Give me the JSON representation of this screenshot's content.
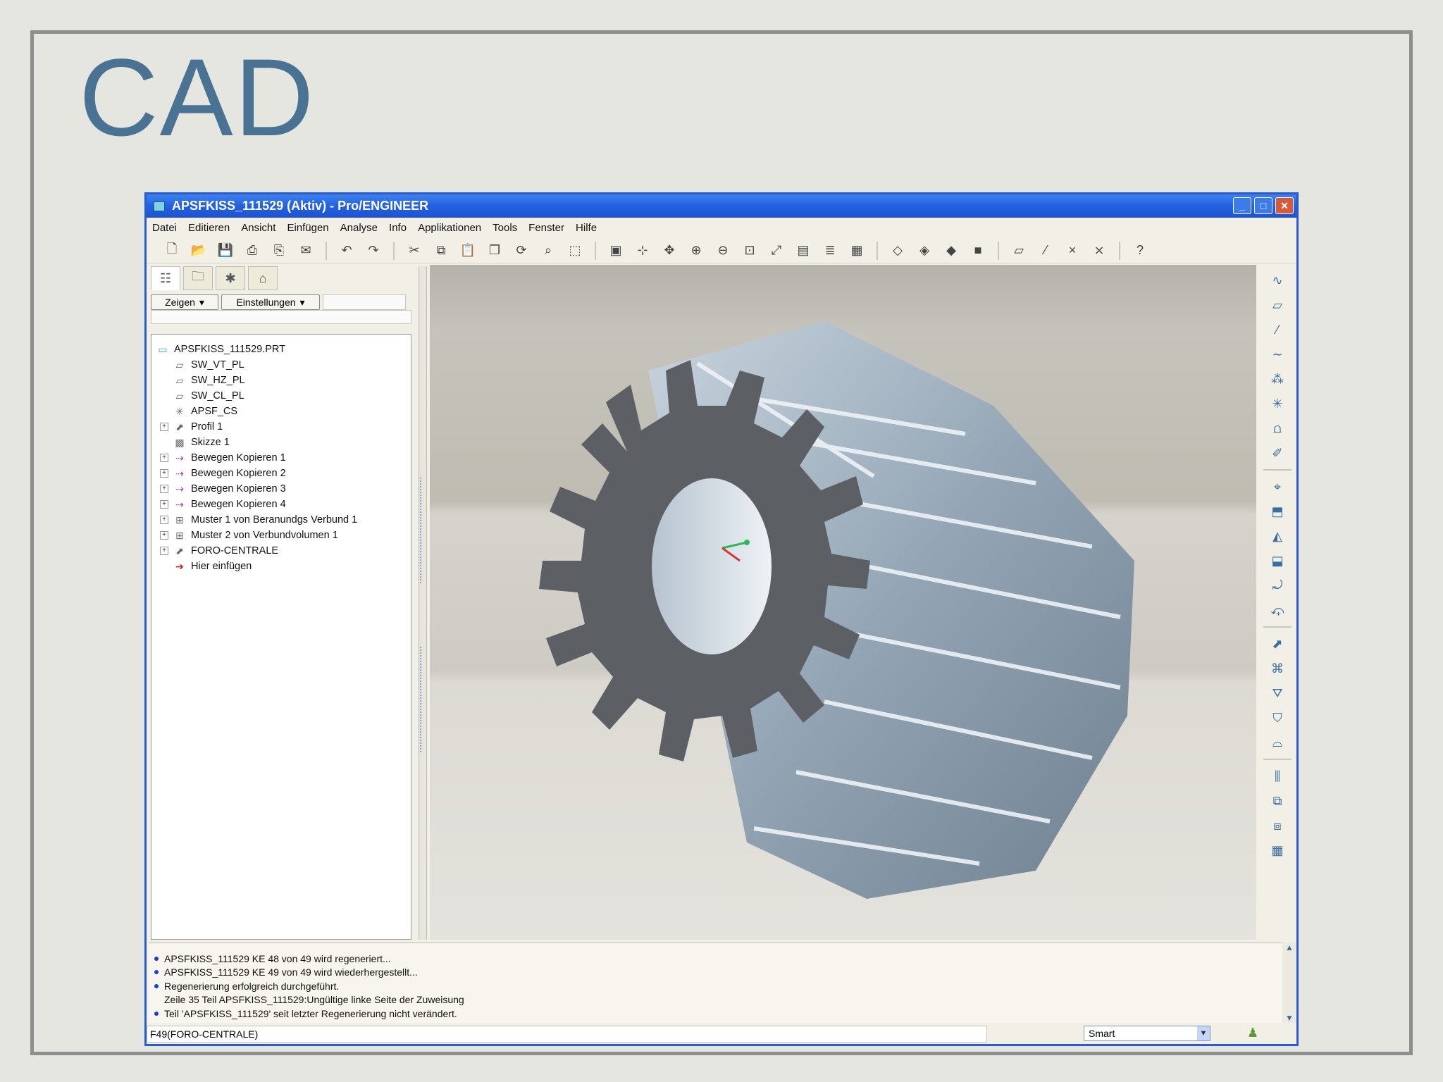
{
  "slide": {
    "title": "CAD"
  },
  "window": {
    "title": "APSFKISS_111529 (Aktiv) - Pro/ENGINEER",
    "controls": {
      "minimize": "_",
      "maximize": "□",
      "close": "✕"
    }
  },
  "menu": [
    "Datei",
    "Editieren",
    "Ansicht",
    "Einfügen",
    "Analyse",
    "Info",
    "Applikationen",
    "Tools",
    "Fenster",
    "Hilfe"
  ],
  "toolbar": {
    "icons": [
      "new-icon",
      "open-icon",
      "save-icon",
      "print-icon",
      "print-preview-icon",
      "email-icon",
      "undo-icon",
      "redo-icon",
      "cut-icon",
      "copy-icon",
      "paste-icon",
      "paste-special-icon",
      "regenerate-icon",
      "find-icon",
      "select-box-icon",
      "repaint-icon",
      "spin-center-icon",
      "orient-icon",
      "zoom-in-icon",
      "zoom-out-icon",
      "refit-icon",
      "reorient-icon",
      "saved-views-icon",
      "layers-icon",
      "view-manager-icon",
      "wireframe-icon",
      "hidden-line-icon",
      "no-hidden-icon",
      "shading-icon",
      "datum-planes-icon",
      "datum-axes-icon",
      "datum-points-icon",
      "coordinate-systems-icon",
      "context-help-icon"
    ]
  },
  "panel": {
    "show_button": "Zeigen",
    "settings_button": "Einstellungen",
    "tree": [
      {
        "label": "APSFKISS_111529.PRT",
        "icon": "part-icon",
        "expandable": false,
        "level": 0
      },
      {
        "label": "SW_VT_PL",
        "icon": "datum-plane-icon",
        "expandable": false,
        "level": 1
      },
      {
        "label": "SW_HZ_PL",
        "icon": "datum-plane-icon",
        "expandable": false,
        "level": 1
      },
      {
        "label": "SW_CL_PL",
        "icon": "datum-plane-icon",
        "expandable": false,
        "level": 1
      },
      {
        "label": "APSF_CS",
        "icon": "coordinate-system-icon",
        "expandable": false,
        "level": 1
      },
      {
        "label": "Profil 1",
        "icon": "profile-icon",
        "expandable": true,
        "level": 1
      },
      {
        "label": "Skizze 1",
        "icon": "sketch-icon",
        "expandable": false,
        "level": 1
      },
      {
        "label": "Bewegen Kopieren 1",
        "icon": "move-copy-icon",
        "expandable": true,
        "level": 1
      },
      {
        "label": "Bewegen Kopieren 2",
        "icon": "move-copy-icon",
        "expandable": true,
        "level": 1
      },
      {
        "label": "Bewegen Kopieren 3",
        "icon": "move-copy-icon",
        "expandable": true,
        "level": 1
      },
      {
        "label": "Bewegen Kopieren 4",
        "icon": "move-copy-icon",
        "expandable": true,
        "level": 1
      },
      {
        "label": "Muster 1 von Beranundgs Verbund 1",
        "icon": "pattern-icon",
        "expandable": true,
        "level": 1
      },
      {
        "label": "Muster 2 von Verbundvolumen 1",
        "icon": "pattern-icon",
        "expandable": true,
        "level": 1
      },
      {
        "label": "FORO-CENTRALE",
        "icon": "hole-icon",
        "expandable": true,
        "level": 1
      },
      {
        "label": "Hier einfügen",
        "icon": "insert-here-icon",
        "expandable": false,
        "level": 1
      }
    ]
  },
  "messages": [
    {
      "text": "APSFKISS_111529 KE 48 von 49 wird regeneriert...",
      "bullet": true
    },
    {
      "text": "APSFKISS_111529 KE 49 von 49 wird wiederhergestellt...",
      "bullet": true
    },
    {
      "text": "Regenerierung erfolgreich durchgeführt.",
      "bullet": true
    },
    {
      "text": "Zeile 35 Teil APSFKISS_111529:Ungültige linke Seite der Zuweisung",
      "bullet": false
    },
    {
      "text": "Teil 'APSFKISS_111529' seit letzter Regenerierung nicht verändert.",
      "bullet": true
    }
  ],
  "status": {
    "left_text": "F49(FORO-CENTRALE)",
    "filter_value": "Smart"
  },
  "colors": {
    "title": "#4a7292",
    "titlebar": "#2460df",
    "gear_face": "#5c5f63",
    "gear_teeth": "#a9b8c6"
  }
}
